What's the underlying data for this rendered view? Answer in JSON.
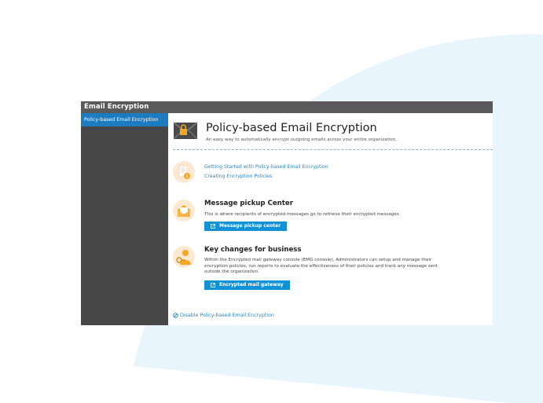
{
  "window": {
    "title": "Email Encryption"
  },
  "sidebar": {
    "items": [
      {
        "label": "Policy-based Email Encryption",
        "selected": true
      }
    ]
  },
  "header": {
    "title": "Policy-based Email Encryption",
    "subtitle": "An easy way to automatically encrypt outgoing emails across your entire organization.",
    "icon": "envelope-lock-icon"
  },
  "docs_section": {
    "icon": "document-info-icon",
    "links": [
      {
        "label": "Getting Started with Policy-based Email Encryption"
      },
      {
        "label": "Creating Encryption Policies"
      }
    ]
  },
  "pickup_section": {
    "icon": "open-envelope-icon",
    "title": "Message pickup Center",
    "description": "This is where recipients of encrypted messages go to retrieve their encrypted messages.",
    "button_label": "Message pickup center"
  },
  "business_section": {
    "icon": "user-key-icon",
    "title": "Key changes for business",
    "description_lines": [
      "Within the Encrypted mail gateway console (EMG console), Administrators can setup and manage their",
      "encryption policies, run reports to evaluate the effectiveness of their policies and track any message sent",
      "outside the organization."
    ],
    "button_label": "Encrypted mail gateway"
  },
  "footer": {
    "disable_label": "Disable Policy-based Email Encryption"
  },
  "colors": {
    "accent": "#1192d6",
    "link": "#2b86c9",
    "sidebar_selected": "#1d7bbf",
    "sidebar_bg": "#474747",
    "titlebar_bg": "#5a5a5a",
    "icon_orange": "#f5a623",
    "icon_circle": "#fde9d2",
    "background_shape": "#e8f5fc"
  }
}
